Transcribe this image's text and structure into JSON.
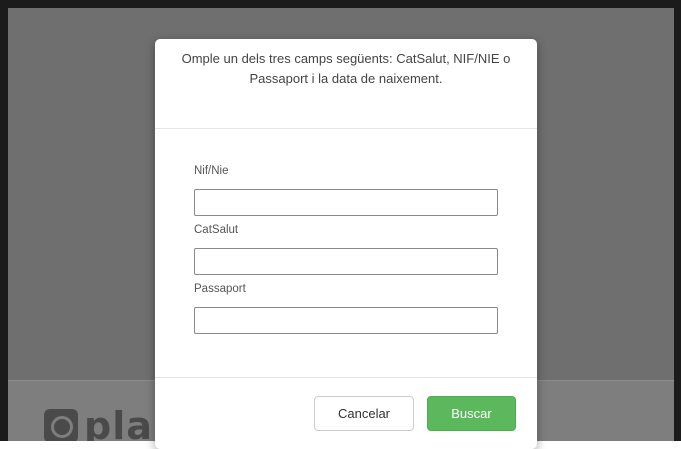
{
  "background": {
    "logo_text": "pla"
  },
  "modal": {
    "header_text": "Omple un dels tres camps següents: CatSalut, NIF/NIE o Passaport i la data de naixement.",
    "fields": [
      {
        "label": "Nif/Nie",
        "value": "",
        "placeholder": ""
      },
      {
        "label": "CatSalut",
        "value": "",
        "placeholder": ""
      },
      {
        "label": "Passaport",
        "value": "",
        "placeholder": ""
      }
    ],
    "buttons": {
      "cancel_label": "Cancelar",
      "search_label": "Buscar"
    }
  },
  "colors": {
    "backdrop": "#6f6f6f",
    "primary_button": "#5cb85c",
    "frame": "#1b1b1b"
  }
}
